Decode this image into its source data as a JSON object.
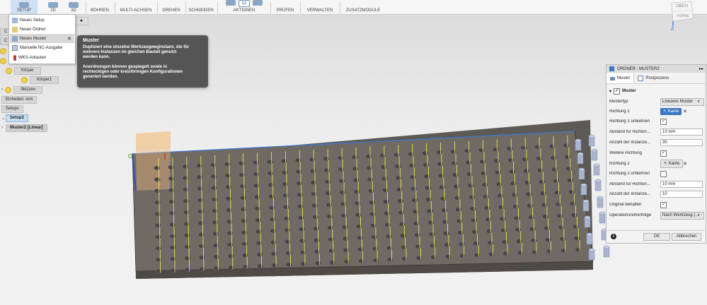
{
  "toolbar": {
    "setup": "SETUP",
    "two_d": "2D",
    "three_d": "3D",
    "bohren": "BOHREN",
    "multi_achsen": "MULTI-ACHSEN",
    "drehen": "DREHEN",
    "schneiden": "SCHNEIDEN",
    "aktionen": "AKTIONEN",
    "pruefen": "PRÜFEN",
    "verwalten": "VERWALTEN",
    "zusatzmodule": "ZUSATZMODULE",
    "g2_label": "G2"
  },
  "setup_menu": {
    "items": [
      "Neues Setup",
      "Neuer Ordner",
      "Neues Muster",
      "Manuelle NC-Ausgabe",
      "WKS-Antasten"
    ],
    "close": "✕"
  },
  "tooltip": {
    "title": "Muster",
    "line1": "Dupliziert eine einzelne Werkzeugweginstanz, die für",
    "line2": "mehrere Instanzen im gleichen Bauteil genutzt",
    "line3": "werden kann.",
    "line4": "Anordnungen können gespiegelt sowie in",
    "line5": "rechteckigen oder kreisförmigen Konfigurationen",
    "line6": "generiert werden."
  },
  "browser": {
    "koerper": "Körper",
    "koerper1": "Körper1",
    "skizzen": "Skizzen",
    "einheiten": "Einheiten: mm",
    "setups": "Setups",
    "setup2": "Setup2",
    "muster2": "Muster2 [Linear]",
    "partial_c1": "C",
    "partial_c2": "C"
  },
  "viewcube": {
    "top": "OBEN",
    "front": "VORNE",
    "axis": "Z"
  },
  "panel": {
    "header": "ORDNER : MUSTER2",
    "tab1": "Muster",
    "tab2": "Postprozess",
    "section": "Muster",
    "rows": {
      "mustertyp_label": "Mustertyp",
      "mustertyp_value": "Lineares Muster",
      "richtung1_label": "Richtung 1",
      "kante1": "Kante",
      "richtung1_umkehren": "Richtung 1 umkehren",
      "abstand1_label": "Abstand für Richtun...",
      "abstand1_value": "10 mm",
      "anzahl1_label": "Anzahl der Instanze...",
      "anzahl1_value": "30",
      "weitere_richtung": "Weitere Richtung",
      "richtung2_label": "Richtung 2",
      "kante2": "Kante",
      "richtung2_umkehren": "Richtung 2 umkehren",
      "abstand2_label": "Abstand für Richtun...",
      "abstand2_value": "10 mm",
      "anzahl2_label": "Anzahl der Instanze...",
      "anzahl2_value": "10",
      "original_behalten": "Original behalten",
      "reihenfolge_label": "Operationsreihenfolge",
      "reihenfolge_value": "Nach Werkzeug (..."
    },
    "ok": "OK",
    "cancel": "Abbrechen",
    "check": "✓",
    "clear": "✕"
  },
  "colors": {
    "accent": "#3b78c4",
    "plate": "#6e6963",
    "toolpath": "#e8e84a",
    "tooltip_bg": "#555555"
  }
}
